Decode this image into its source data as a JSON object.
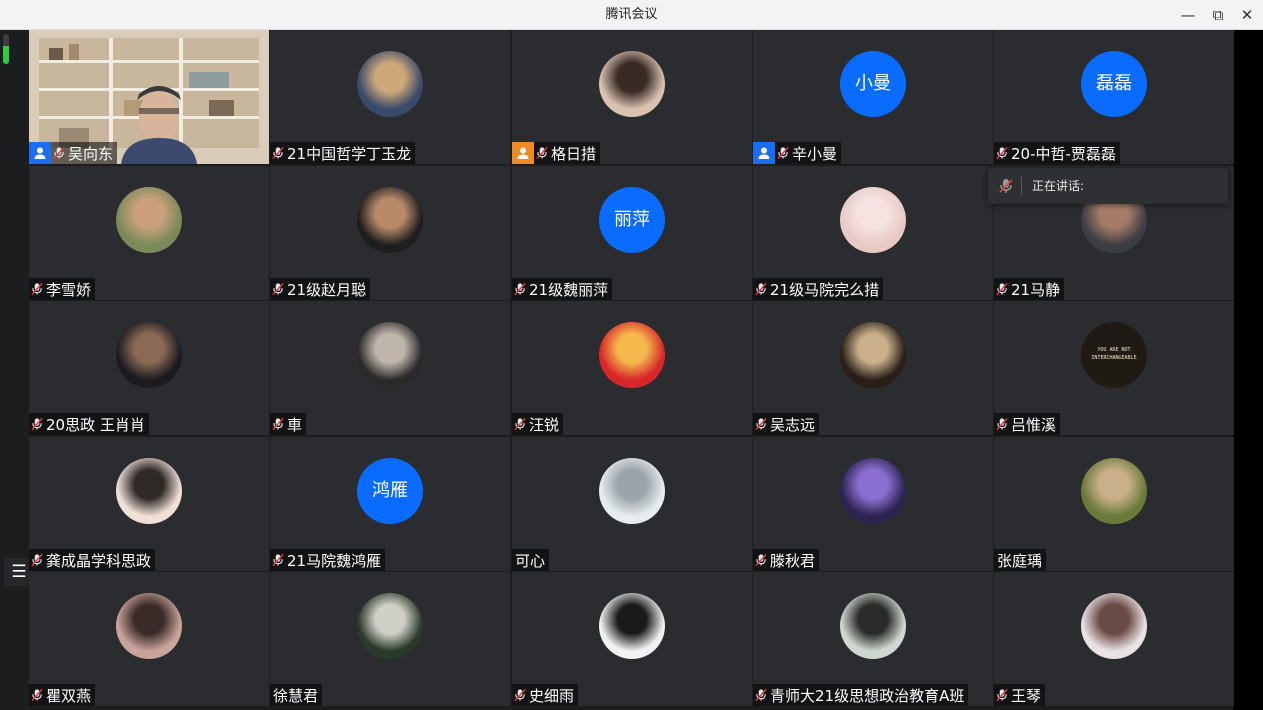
{
  "window": {
    "title": "腾讯会议",
    "minimize": "—",
    "restore": "⧉",
    "close": "✕"
  },
  "audio_level": 0.6,
  "speaking_indicator": {
    "label": "正在讲话:"
  },
  "participants": [
    {
      "name": "吴向东",
      "badge": "host",
      "video": true
    },
    {
      "name": "21中国哲学丁玉龙",
      "avatar": "photo"
    },
    {
      "name": "格日措",
      "badge": "cohost",
      "avatar": "photo"
    },
    {
      "name": "辛小曼",
      "badge": "host",
      "avatar_text": "小曼"
    },
    {
      "name": "20-中哲-贾磊磊",
      "avatar_text": "磊磊"
    },
    {
      "name": "李雪娇",
      "avatar": "photo"
    },
    {
      "name": "21级赵月聪",
      "avatar": "photo"
    },
    {
      "name": "21级魏丽萍",
      "avatar_text": "丽萍"
    },
    {
      "name": "21级马院完么措",
      "avatar": "photo"
    },
    {
      "name": "21马静",
      "avatar": "photo"
    },
    {
      "name": "20思政 王肖肖",
      "avatar": "photo"
    },
    {
      "name": "車",
      "avatar": "photo"
    },
    {
      "name": "汪锐",
      "avatar": "photo"
    },
    {
      "name": "吴志远",
      "avatar": "photo"
    },
    {
      "name": "吕惟溪",
      "avatar": "photo",
      "avatar_caption": "YOU ARE NOT INTERCHANGEABLE"
    },
    {
      "name": "龚成晶学科思政",
      "avatar": "photo"
    },
    {
      "name": "21马院魏鸿雁",
      "avatar_text": "鸿雁"
    },
    {
      "name": "可心",
      "mic": false,
      "avatar": "photo"
    },
    {
      "name": "滕秋君",
      "avatar": "photo"
    },
    {
      "name": "张庭瑀",
      "mic": false,
      "avatar": "photo"
    },
    {
      "name": "瞿双燕",
      "avatar": "photo"
    },
    {
      "name": "徐慧君",
      "mic": false,
      "avatar": "photo"
    },
    {
      "name": "史细雨",
      "avatar": "photo"
    },
    {
      "name": "青师大21级思想政治教育A班",
      "avatar": "photo"
    },
    {
      "name": "王琴",
      "avatar": "photo"
    }
  ]
}
